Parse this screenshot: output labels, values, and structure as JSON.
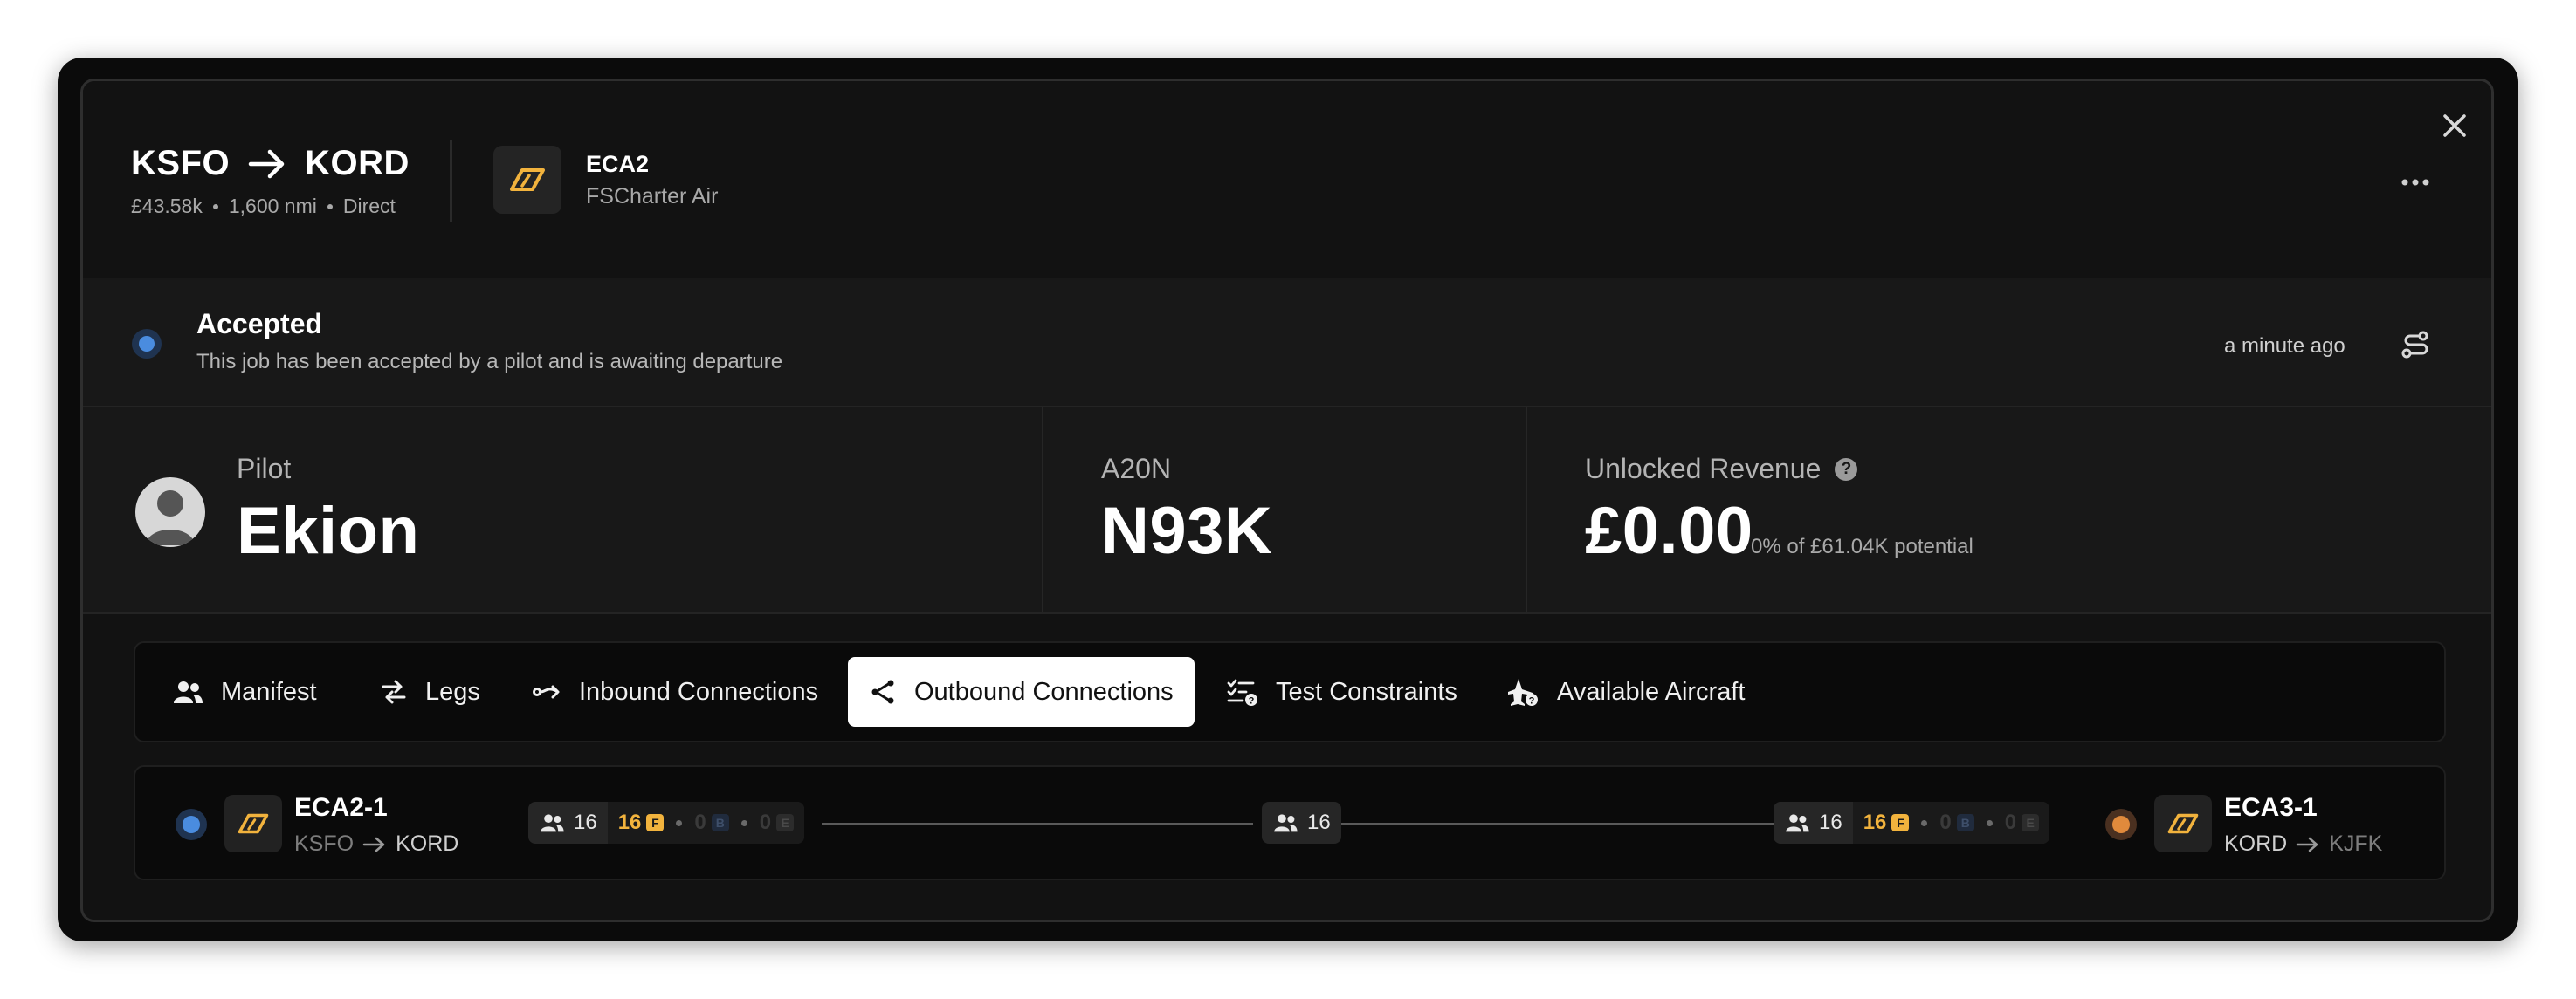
{
  "job": {
    "origin": "KSFO",
    "destination": "KORD",
    "value": "£43.58k",
    "distance": "1,600 nmi",
    "routing": "Direct",
    "airline_code": "ECA2",
    "airline_name": "FSCharter Air"
  },
  "status": {
    "title": "Accepted",
    "description": "This job has been accepted by a pilot and is awaiting departure",
    "time": "a minute ago",
    "color": "#4a8cdf"
  },
  "stats": {
    "pilot_label": "Pilot",
    "pilot_name": "Ekion",
    "aircraft_type": "A20N",
    "aircraft_reg": "N93K",
    "revenue_label": "Unlocked Revenue",
    "revenue_value": "£0.00",
    "revenue_sub": "0% of £61.04K potential"
  },
  "tabs": [
    {
      "label": "Manifest",
      "icon": "users-icon"
    },
    {
      "label": "Legs",
      "icon": "legs-icon"
    },
    {
      "label": "Inbound Connections",
      "icon": "inbound-icon"
    },
    {
      "label": "Outbound Connections",
      "icon": "share-icon",
      "active": true
    },
    {
      "label": "Test Constraints",
      "icon": "checklist-help-icon"
    },
    {
      "label": "Available Aircraft",
      "icon": "plane-help-icon"
    }
  ],
  "connection": {
    "left": {
      "code": "ECA2-1",
      "from": "KSFO",
      "to": "KORD",
      "dot_color": "#4a8cdf"
    },
    "right": {
      "code": "ECA3-1",
      "from": "KORD",
      "to": "KJFK",
      "dot_color": "#e08a3c"
    },
    "left_pill": {
      "pax": "16",
      "first": "16",
      "first_badge": "F",
      "business": "0",
      "business_badge": "B",
      "economy": "0",
      "economy_badge": "E"
    },
    "mid_pill": {
      "pax": "16"
    },
    "right_pill": {
      "pax": "16",
      "first": "16",
      "first_badge": "F",
      "business": "0",
      "business_badge": "B",
      "economy": "0",
      "economy_badge": "E"
    }
  },
  "colors": {
    "accent": "#f2b33d",
    "background": "#121212"
  }
}
